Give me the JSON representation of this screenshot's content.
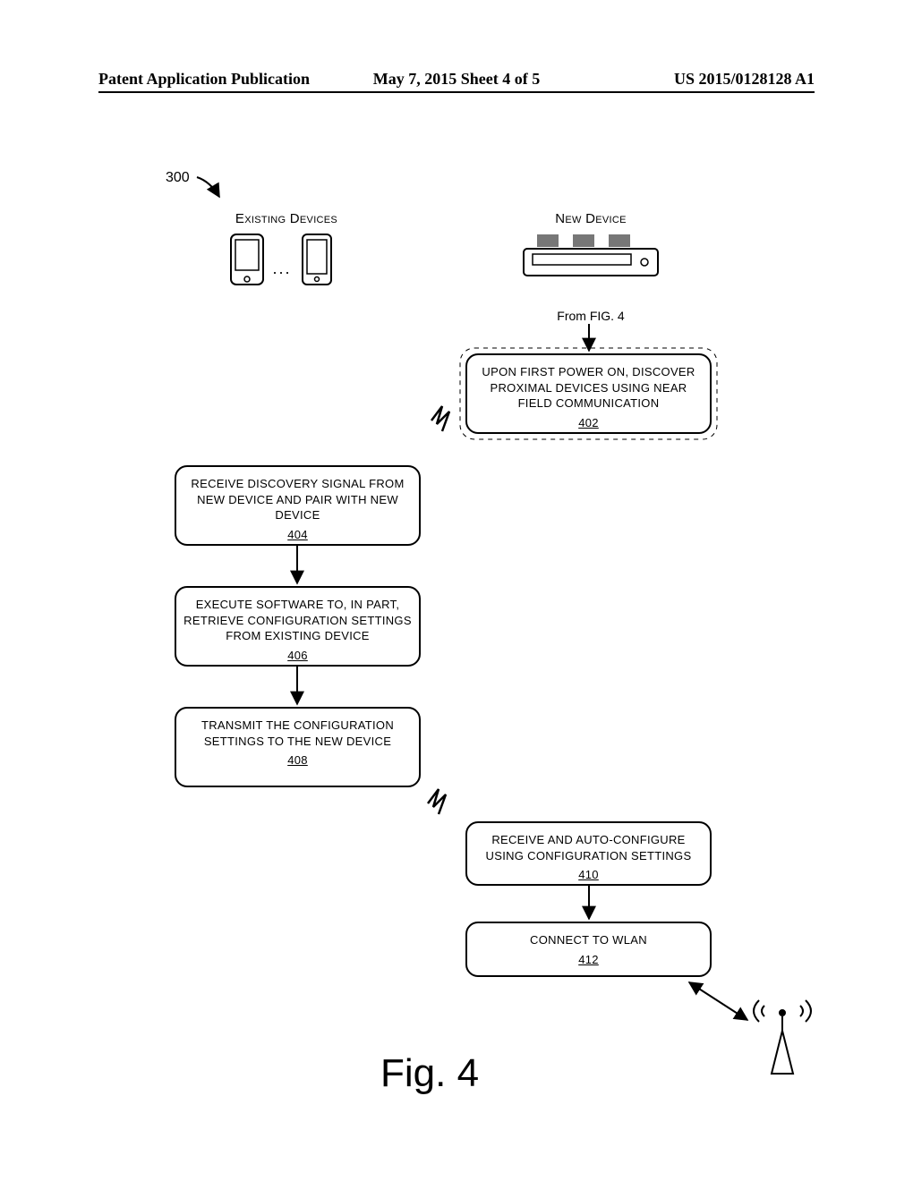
{
  "header": {
    "left": "Patent Application Publication",
    "center": "May 7, 2015   Sheet 4 of 5",
    "right": "US 2015/0128128 A1"
  },
  "flow": {
    "ref_num": "300",
    "existing_label": "Existing Devices",
    "new_label": "New Device",
    "from_fig": "From FIG. 4",
    "boxes": {
      "b402": {
        "text": "Upon first power on, discover proximal devices using Near Field Communication",
        "ref": "402"
      },
      "b404": {
        "text": "Receive discovery signal from new device and pair with new device",
        "ref": "404"
      },
      "b406": {
        "text": "Execute software to, in part, retrieve configuration settings from existing device",
        "ref": "406"
      },
      "b408": {
        "text": "Transmit the configuration settings to the new device",
        "ref": "408"
      },
      "b410": {
        "text": "Receive and Auto-configure using configuration settings",
        "ref": "410"
      },
      "b412": {
        "text": "Connect to WLAN",
        "ref": "412"
      }
    },
    "ellipsis": "..."
  },
  "figure_caption": "Fig. 4"
}
